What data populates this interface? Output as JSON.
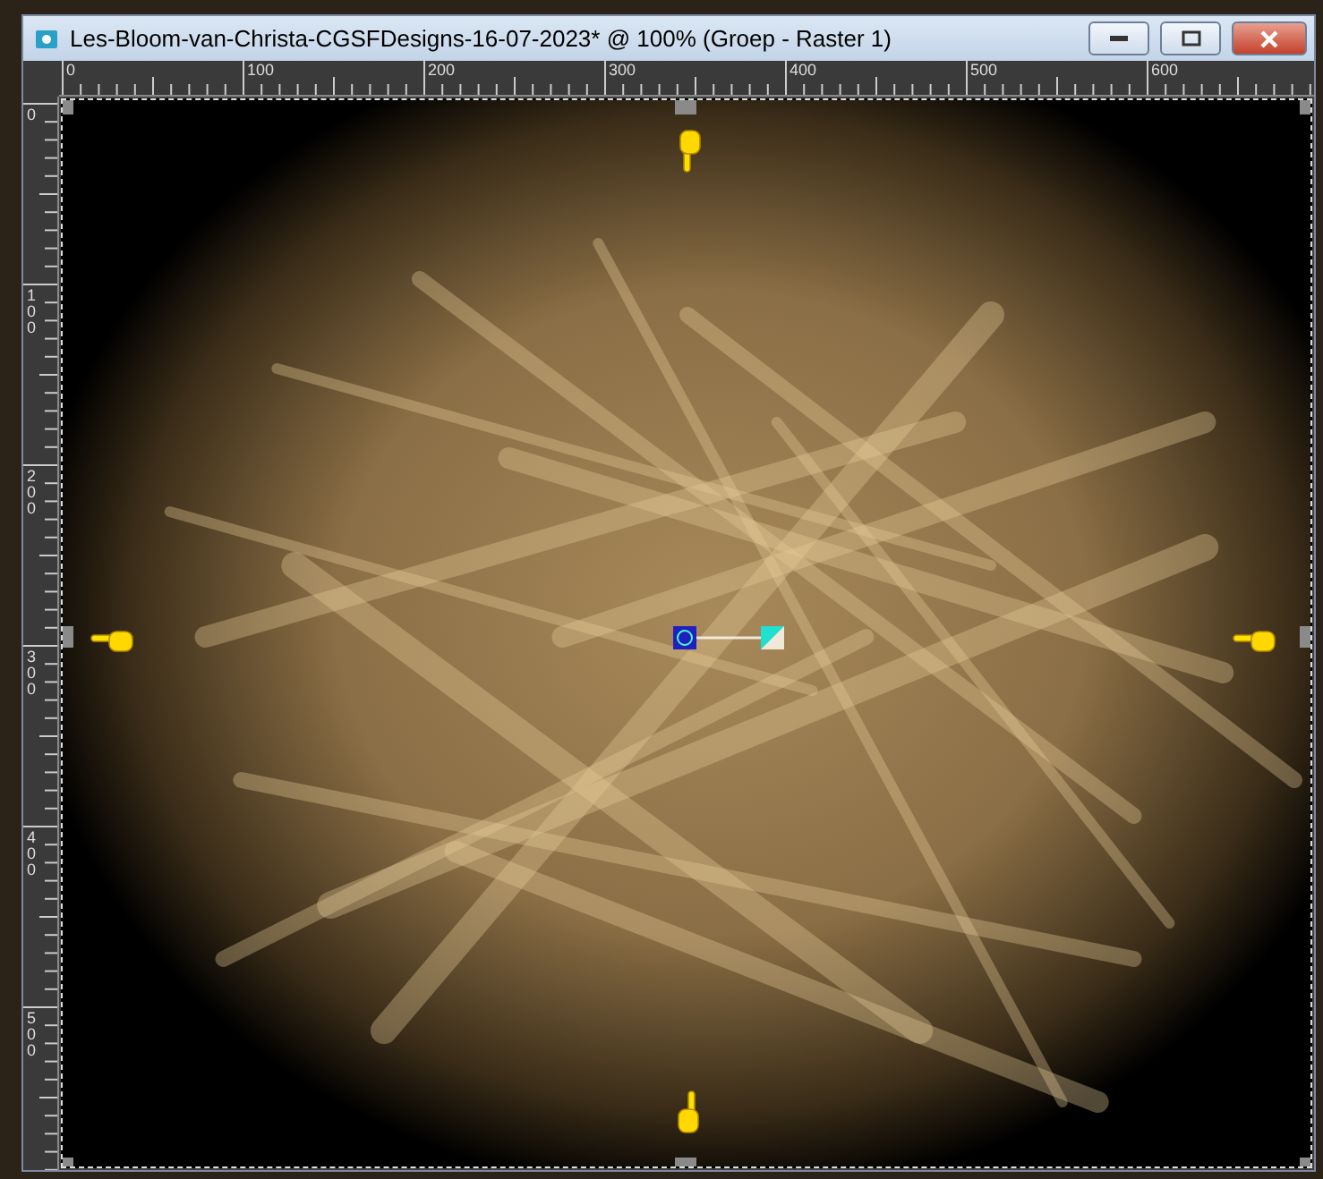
{
  "window": {
    "title": "Les-Bloom-van-Christa-CGSFDesigns-16-07-2023* @ 100% (Groep - Raster 1)"
  },
  "ruler_top": {
    "labels": [
      "0",
      "100",
      "200",
      "300",
      "400",
      "500",
      "600"
    ]
  },
  "ruler_left": {
    "labels": [
      "0",
      "100",
      "200",
      "300",
      "400",
      "500"
    ]
  }
}
